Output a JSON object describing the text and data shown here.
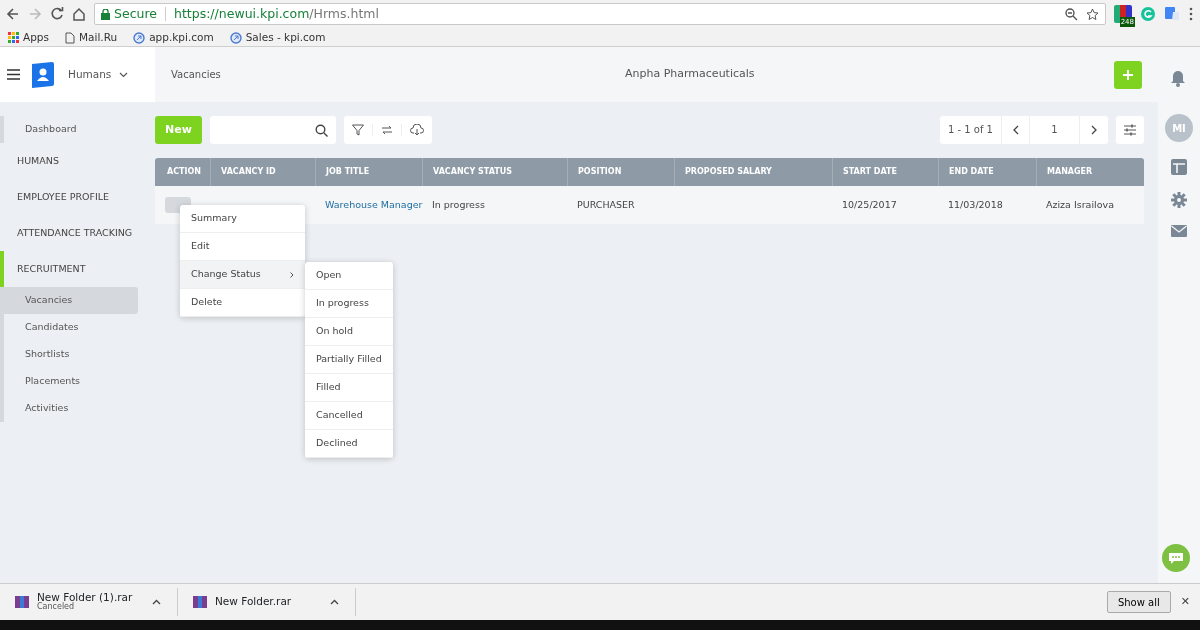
{
  "browser": {
    "secure_label": "Secure",
    "url_host": "https://newui.kpi.com",
    "url_path": "/Hrms.html",
    "extension_badge": "248",
    "bookmarks": [
      {
        "label": "Apps",
        "kind": "apps"
      },
      {
        "label": "Mail.Ru",
        "kind": "page"
      },
      {
        "label": "app.kpi.com",
        "kind": "link"
      },
      {
        "label": "Sales - kpi.com",
        "kind": "link"
      }
    ]
  },
  "app": {
    "module": "Humans",
    "breadcrumb": "Vacancies",
    "company": "Anpha Pharmaceuticals",
    "avatar": "MI"
  },
  "sidebar": {
    "items": [
      {
        "label": "Dashboard",
        "kind": "sub",
        "selected": false
      },
      {
        "label": "HUMANS",
        "kind": "section",
        "expanded": false
      },
      {
        "label": "EMPLOYEE PROFILE",
        "kind": "section",
        "expanded": false
      },
      {
        "label": "ATTENDANCE TRACKING",
        "kind": "section",
        "expanded": false
      },
      {
        "label": "RECRUITMENT",
        "kind": "section",
        "expanded": true,
        "children": [
          {
            "label": "Vacancies",
            "selected": true
          },
          {
            "label": "Candidates",
            "selected": false
          },
          {
            "label": "Shortlists",
            "selected": false
          },
          {
            "label": "Placements",
            "selected": false
          },
          {
            "label": "Activities",
            "selected": false
          }
        ]
      }
    ]
  },
  "toolbar": {
    "new_button": "New",
    "pager": {
      "range": "1 - 1 of 1",
      "page": "1"
    }
  },
  "table": {
    "columns": [
      "ACTION",
      "VACANCY ID",
      "JOB TITLE",
      "VACANCY STATUS",
      "POSITION",
      "PROPOSED SALARY",
      "START DATE",
      "END DATE",
      "MANAGER"
    ],
    "rows": [
      {
        "job_title": "Warehouse Manager",
        "status": "In progress",
        "position": "PURCHASER",
        "start_date": "10/25/2017",
        "end_date": "11/03/2018",
        "manager": "Aziza Israilova"
      }
    ]
  },
  "context_menu": {
    "items": [
      {
        "label": "Summary",
        "highlighted": false
      },
      {
        "label": "Edit",
        "highlighted": false
      },
      {
        "label": "Change Status",
        "highlighted": true,
        "submenu": true
      },
      {
        "label": "Delete",
        "highlighted": false
      }
    ],
    "submenu": [
      "Open",
      "In progress",
      "On hold",
      "Partially Filled",
      "Filled",
      "Cancelled",
      "Declined"
    ]
  },
  "downloads": {
    "items": [
      {
        "name": "New Folder (1).rar",
        "status": "Canceled"
      },
      {
        "name": "New Folder.rar"
      }
    ],
    "show_all": "Show all",
    "close": "✕"
  }
}
